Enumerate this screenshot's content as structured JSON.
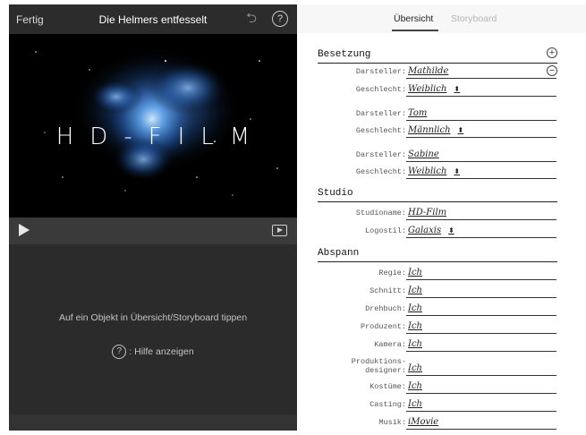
{
  "left": {
    "topbar": {
      "done": "Fertig",
      "title": "Die Helmers entfesselt",
      "undo_icon": "undo-icon",
      "help_icon": "help-icon",
      "help_glyph": "?"
    },
    "video": {
      "title_text": "HD-FILM"
    },
    "controls": {
      "play_icon": "play-icon",
      "fullscreen_icon": "fullscreen-icon"
    },
    "info": {
      "hint": "Auf ein Objekt in Übersicht/Storyboard tippen",
      "help_glyph": "?",
      "help_text": ": Hilfe anzeigen"
    }
  },
  "right": {
    "tabs": [
      "Übersicht",
      "Storyboard"
    ],
    "active_tab": "Übersicht",
    "sections": {
      "cast": {
        "title": "Besetzung",
        "add_glyph": "+",
        "remove_glyph": "−",
        "members": [
          {
            "actor_label": "Darsteller:",
            "actor": "Mathilde",
            "gender_label": "Geschlecht:",
            "gender": "Weiblich"
          },
          {
            "actor_label": "Darsteller:",
            "actor": "Tom",
            "gender_label": "Geschlecht:",
            "gender": "Männlich"
          },
          {
            "actor_label": "Darsteller:",
            "actor": "Sabine",
            "gender_label": "Geschlecht:",
            "gender": "Weiblich"
          }
        ]
      },
      "studio": {
        "title": "Studio",
        "name_label": "Studioname:",
        "name": "HD-Film",
        "logo_label": "Logostil:",
        "logo": "Galaxis"
      },
      "credits": {
        "title": "Abspann",
        "rows": [
          {
            "label": "Regie:",
            "value": "Ich"
          },
          {
            "label": "Schnitt:",
            "value": "Ich"
          },
          {
            "label": "Drehbuch:",
            "value": "Ich"
          },
          {
            "label": "Produzent:",
            "value": "Ich"
          },
          {
            "label": "Kamera:",
            "value": "Ich"
          },
          {
            "label": "Produktions-\ndesigner:",
            "value": "Ich"
          },
          {
            "label": "Kostüme:",
            "value": "Ich"
          },
          {
            "label": "Casting:",
            "value": "Ich"
          },
          {
            "label": "Musik:",
            "value": "iMovie"
          }
        ]
      }
    },
    "caret": "⬍"
  },
  "colors": {
    "left_bg": "#2b2b2b",
    "nebula": "#3f7fd0"
  }
}
